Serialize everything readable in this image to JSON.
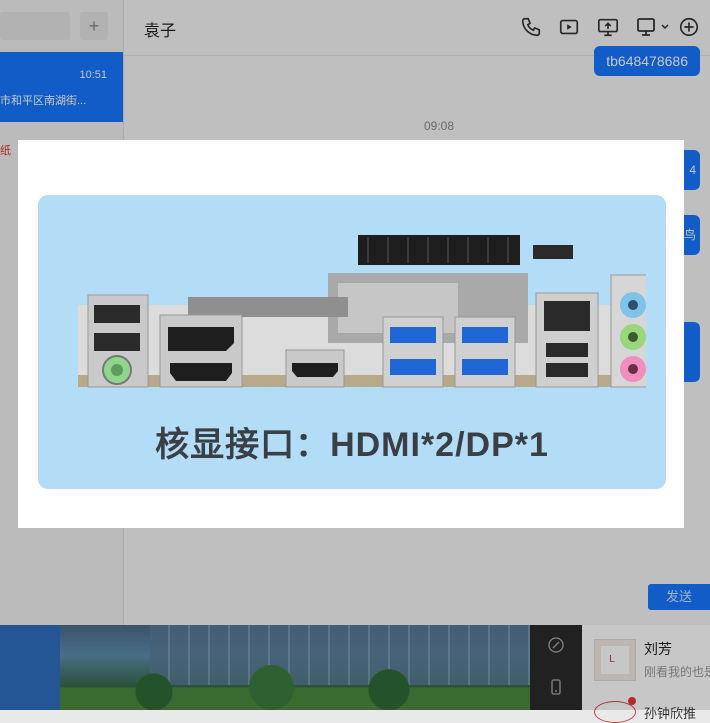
{
  "left": {
    "add_symbol": "+",
    "chat_time": "10:51",
    "chat_preview": "市和平区南湖街...",
    "red_snippet": "纸"
  },
  "chat": {
    "contact_name": "袁子",
    "my_message": "tb648478686",
    "time_divider": "09:08",
    "edge_text_1": "4",
    "edge_text_2": "鸟",
    "send_label": "发送"
  },
  "toolbar_icons": [
    "phone-icon",
    "video-icon",
    "screen-share-icon",
    "remote-desktop-icon",
    "add-icon"
  ],
  "bottom": {
    "contact_name": "刘芳",
    "contact_sub": "刚看我的也是",
    "contact2_name": "孙钟欣推"
  },
  "viewer": {
    "caption": "核显接口：HDMI*2/DP*1"
  },
  "colors": {
    "accent": "#1677ff",
    "banner": "#b3dcf6"
  }
}
